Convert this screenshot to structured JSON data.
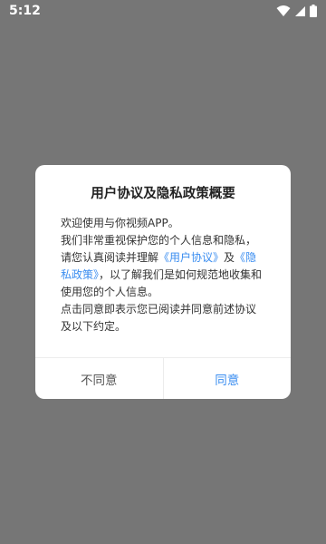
{
  "status_bar": {
    "time": "5:12",
    "icons": [
      "wifi-icon",
      "signal-icon",
      "battery-icon"
    ]
  },
  "dialog": {
    "title": "用户协议及隐私政策概要",
    "paragraph1_text1": "欢迎使用与你视频APP。",
    "paragraph1_text2": "我们非常重视保护您的个人信息和隐私，请您认真阅读并理解",
    "link_user_agreement": "《用户协议》",
    "and_text": "及",
    "link_privacy_policy": "《隐私政策》",
    "paragraph1_text3": "，以了解我们是如何规范地收集和使用您的个人信息。",
    "paragraph2": "点击同意即表示您已阅读并同意前述协议及以下约定。",
    "buttons": {
      "disagree_label": "不同意",
      "agree_label": "同意"
    }
  },
  "colors": {
    "overlay": "#767676",
    "link": "#3a8df0",
    "dialog_bg": "#ffffff"
  }
}
